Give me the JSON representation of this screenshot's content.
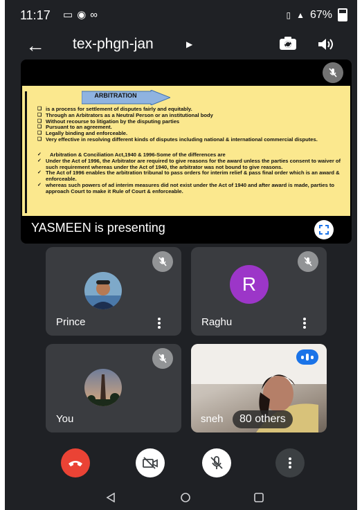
{
  "status_bar": {
    "time": "11:17",
    "notification_icons": [
      "cast-icon",
      "facebook-icon",
      "link-icon"
    ],
    "network": "4G",
    "battery": "67%"
  },
  "app_bar": {
    "meeting_code": "tex-phgn-jan"
  },
  "presenter": {
    "label": "YASMEEN is presenting",
    "slide": {
      "heading": "ARBITRATION",
      "bullets": [
        "is a process for settlement of disputes fairly and equitably.",
        "Through an Arbitrators as a Neutral Person or an institutional body",
        "Without recourse to litigation by the disputing parties",
        "Pursuant to an agreement.",
        "Legally binding and enforceable.",
        "Very effective in resolving different kinds of disputes including national & international commercial disputes."
      ],
      "points": [
        "Arbitration & Conciliation Act,1940 & 1996-Some of the differences are",
        "Under the Act of 1996, the Arbitrator are required to give reasons for the award unless the parties consent to waiver of such requirement whereas under the Act of 1940, the arbitrator was not bound to give reasons.",
        "The Act of 1996 enables the arbitration tribunal to pass orders for interim relief & pass final order which is an award & enforceable.",
        "whereas such powers of ad interim measures did not exist under the Act of 1940 and after award is made, parties to approach Court to make it Rule of Court & enforceable."
      ]
    }
  },
  "participants": [
    {
      "name": "Prince",
      "avatar": "photo",
      "muted": true
    },
    {
      "name": "Raghu",
      "avatar_letter": "R",
      "avatar_color": "#9c36c8",
      "muted": true
    },
    {
      "name": "You",
      "avatar": "photo",
      "muted": true
    },
    {
      "name": "sneh",
      "others_label": "80 others",
      "speaking": true
    }
  ],
  "controls": {
    "end_call_color": "#ea4335"
  },
  "colors": {
    "background": "#1f2125",
    "tile": "#3a3c40",
    "accent": "#1a73e8",
    "slide_background": "#fbe88e"
  }
}
